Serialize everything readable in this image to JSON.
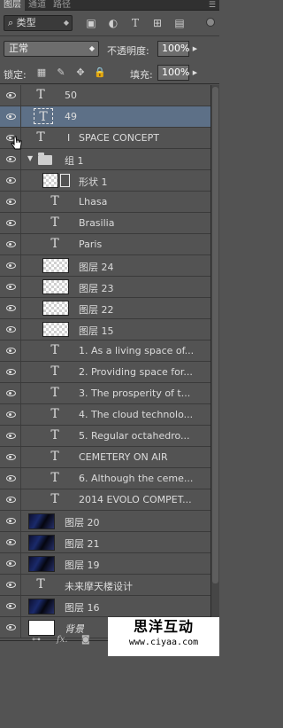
{
  "tabs": [
    {
      "label": "图层",
      "active": true
    },
    {
      "label": "通道",
      "active": false
    },
    {
      "label": "路径",
      "active": false
    }
  ],
  "panel_menu_icon": "panel-menu-icon",
  "filter": {
    "search_icon": "search-icon",
    "kind_label": "类型",
    "icons": [
      "image-filter-icon",
      "adjustment-filter-icon",
      "type-filter-icon",
      "shape-filter-icon",
      "smart-object-filter-icon"
    ]
  },
  "blend": {
    "mode": "正常",
    "opacity_label": "不透明度:",
    "opacity_value": "100%"
  },
  "lock": {
    "label": "锁定:",
    "icons": [
      "lock-transparent-icon",
      "lock-image-icon",
      "lock-position-icon",
      "lock-all-icon"
    ],
    "fill_label": "填充:",
    "fill_value": "100%"
  },
  "layers": [
    {
      "name": "50",
      "kind": "text",
      "indent": 0
    },
    {
      "name": "49",
      "kind": "text",
      "indent": 0,
      "selected": true
    },
    {
      "name": "SPACE CONCEPT",
      "kind": "text",
      "indent": 0,
      "cursor": true
    },
    {
      "name": "组 1",
      "kind": "group",
      "indent": 0
    },
    {
      "name": "形状 1",
      "kind": "shape",
      "indent": 1
    },
    {
      "name": "Lhasa",
      "kind": "text",
      "indent": 1
    },
    {
      "name": "Brasilia",
      "kind": "text",
      "indent": 1
    },
    {
      "name": "Paris",
      "kind": "text",
      "indent": 1
    },
    {
      "name": "图层 24",
      "kind": "pixel",
      "indent": 1
    },
    {
      "name": "图层 23",
      "kind": "pixel",
      "indent": 1
    },
    {
      "name": "图层 22",
      "kind": "pixel",
      "indent": 1
    },
    {
      "name": "图层 15",
      "kind": "pixel",
      "indent": 1
    },
    {
      "name": "1. As a living space of...",
      "kind": "text",
      "indent": 1
    },
    {
      "name": "2. Providing space for...",
      "kind": "text",
      "indent": 1
    },
    {
      "name": "3. The prosperity of t...",
      "kind": "text",
      "indent": 1
    },
    {
      "name": "4. The cloud technolo...",
      "kind": "text",
      "indent": 1
    },
    {
      "name": "5. Regular octahedro...",
      "kind": "text",
      "indent": 1
    },
    {
      "name": "CEMETERY ON AIR",
      "kind": "text",
      "indent": 1
    },
    {
      "name": "6. Although the ceme...",
      "kind": "text",
      "indent": 1
    },
    {
      "name": "2014 EVOLO COMPET...",
      "kind": "text",
      "indent": 1
    },
    {
      "name": "图层 20",
      "kind": "dark",
      "indent": 0
    },
    {
      "name": "图层 21",
      "kind": "dark",
      "indent": 0
    },
    {
      "name": "图层 19",
      "kind": "dark",
      "indent": 0
    },
    {
      "name": "未来摩天楼设计",
      "kind": "text",
      "indent": 0
    },
    {
      "name": "图层 16",
      "kind": "dark",
      "indent": 0
    },
    {
      "name": "背景",
      "kind": "background",
      "indent": 0,
      "locked": true
    }
  ],
  "bottom_icons": [
    "link-layers-icon",
    "layer-style-icon",
    "layer-mask-icon"
  ],
  "watermark": {
    "title": "思洋互动",
    "url": "www.ciyaa.com"
  }
}
